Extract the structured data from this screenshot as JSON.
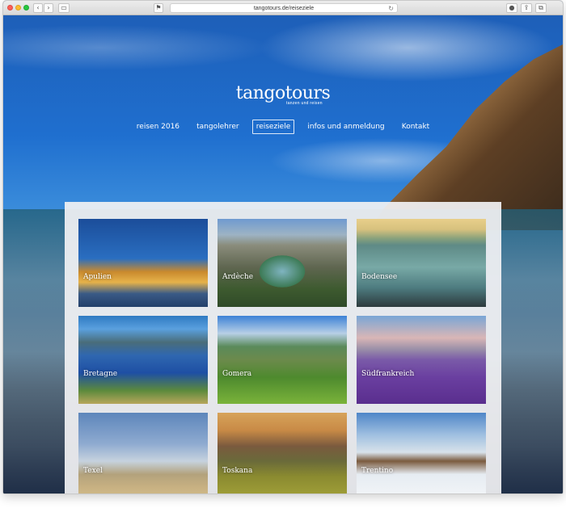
{
  "browser": {
    "url": "tangotours.de/reiseziele"
  },
  "site": {
    "logo": "tangotours",
    "tagline": "tanzen und reisen"
  },
  "nav": [
    {
      "label": "reisen 2016",
      "active": false
    },
    {
      "label": "tangolehrer",
      "active": false
    },
    {
      "label": "reiseziele",
      "active": true
    },
    {
      "label": "infos und anmeldung",
      "active": false
    },
    {
      "label": "Kontakt",
      "active": false
    }
  ],
  "destinations": [
    {
      "label": "Apulien"
    },
    {
      "label": "Ardèche"
    },
    {
      "label": "Bodensee"
    },
    {
      "label": "Bretagne"
    },
    {
      "label": "Gomera"
    },
    {
      "label": "Südfrankreich"
    },
    {
      "label": "Texel"
    },
    {
      "label": "Toskana"
    },
    {
      "label": "Trentino"
    }
  ],
  "colors": {
    "nav_text": "#ffffff",
    "panel": "#f2f2f4"
  }
}
